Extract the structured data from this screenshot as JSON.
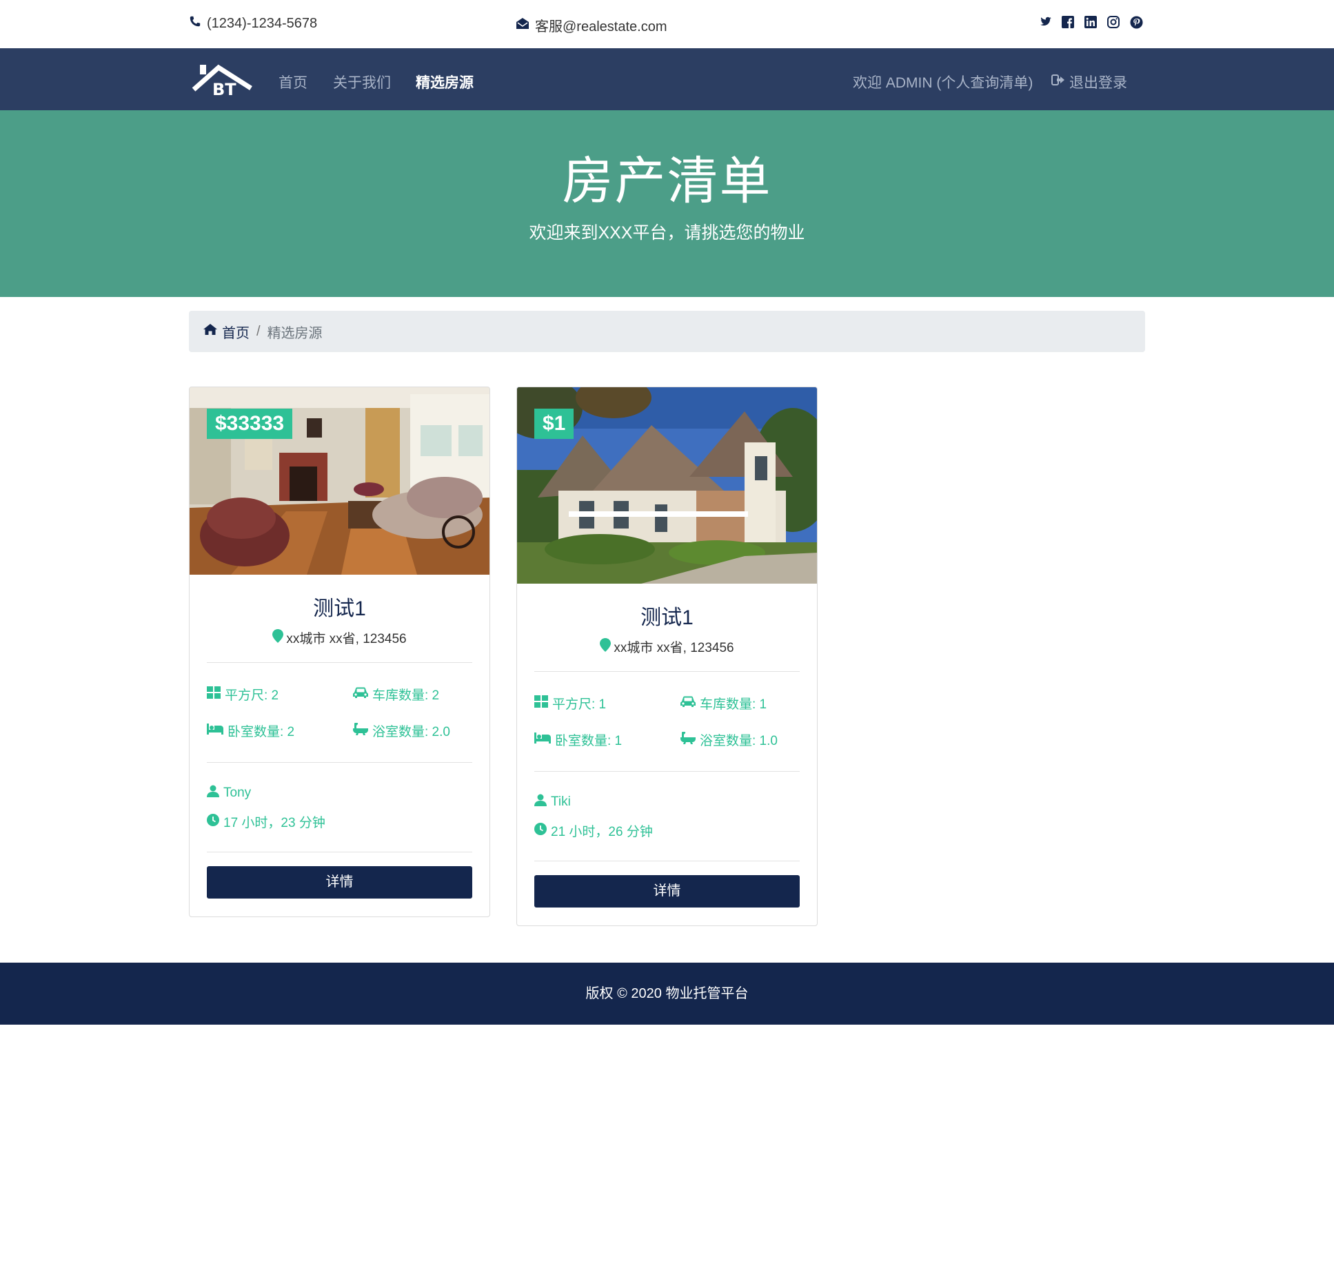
{
  "topbar": {
    "phone": "(1234)-1234-5678",
    "email": "客服@realestate.com",
    "social": [
      "twitter-icon",
      "facebook-icon",
      "linkedin-icon",
      "instagram-icon",
      "pinterest-icon"
    ]
  },
  "navbar": {
    "logo_text": "BT",
    "items": [
      {
        "label": "首页",
        "active": false
      },
      {
        "label": "关于我们",
        "active": false
      },
      {
        "label": "精选房源",
        "active": true
      }
    ],
    "welcome": "欢迎 ADMIN (个人查询清单)",
    "logout": "退出登录"
  },
  "hero": {
    "title": "房产清单",
    "subtitle": "欢迎来到XXX平台，请挑选您的物业"
  },
  "breadcrumb": {
    "home": "首页",
    "separator": "/",
    "current": "精选房源"
  },
  "listings": [
    {
      "price": "$33333",
      "title": "测试1",
      "address": "xx城市 xx省, 123456",
      "sqft": "平方尺: 2",
      "garage": "车库数量: 2",
      "bedrooms": "卧室数量: 2",
      "bathrooms": "浴室数量: 2.0",
      "agent": "Tony",
      "time": "17 小时，23 分钟",
      "button": "详情"
    },
    {
      "price": "$1",
      "title": "测试1",
      "address": "xx城市 xx省, 123456",
      "sqft": "平方尺: 1",
      "garage": "车库数量: 1",
      "bedrooms": "卧室数量: 1",
      "bathrooms": "浴室数量: 1.0",
      "agent": "Tiki",
      "time": "21 小时，26 分钟",
      "button": "详情"
    }
  ],
  "footer": {
    "copyright": "版权 © 2020 物业托管平台"
  },
  "colors": {
    "navy": "#14264d",
    "nav_bg": "#2c3e62",
    "hero_bg": "#4c9e88",
    "accent": "#2ec196"
  }
}
